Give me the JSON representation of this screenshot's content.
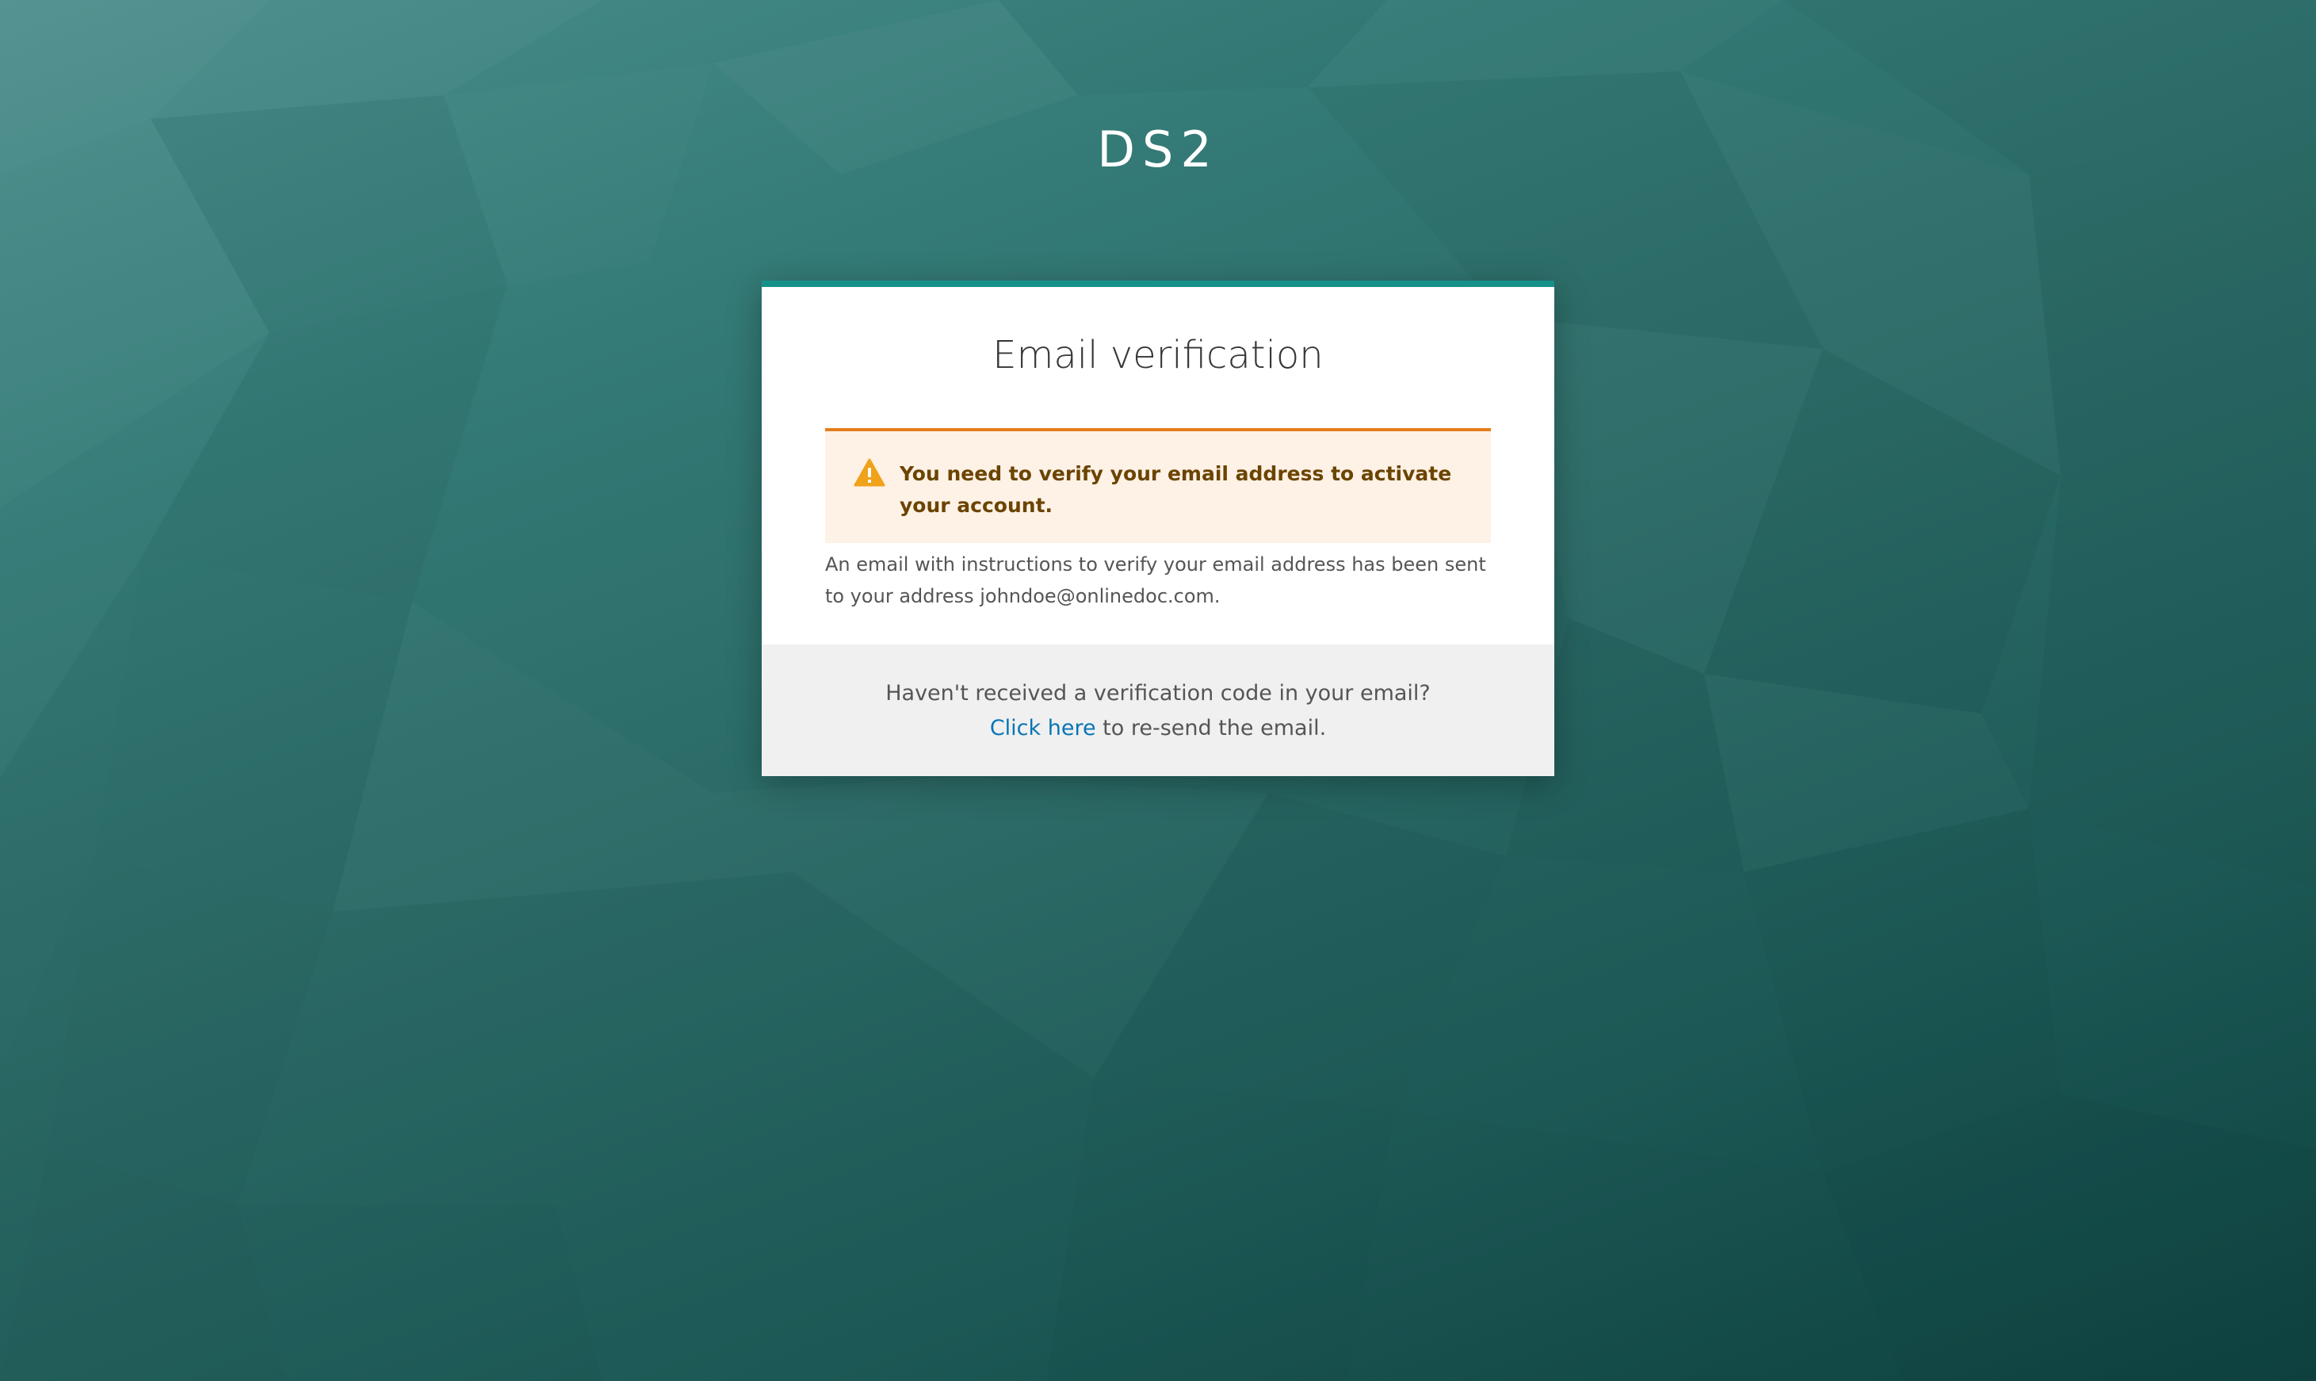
{
  "brand": {
    "name": "DS2"
  },
  "card": {
    "title": "Email verification",
    "alert": {
      "icon": "warning-icon",
      "message": "You need to verify your email address to activate your account."
    },
    "info": "An email with instructions to verify your email address has been sent to your address johndoe@onlinedoc.com.",
    "footer": {
      "question": "Haven't received a verification code in your email?",
      "link_label": "Click here",
      "link_suffix": " to re-send the email."
    }
  },
  "colors": {
    "accent": "#16918a",
    "warning": "#e47e1d",
    "warning_icon": "#f0a21b",
    "link": "#0875b5"
  }
}
